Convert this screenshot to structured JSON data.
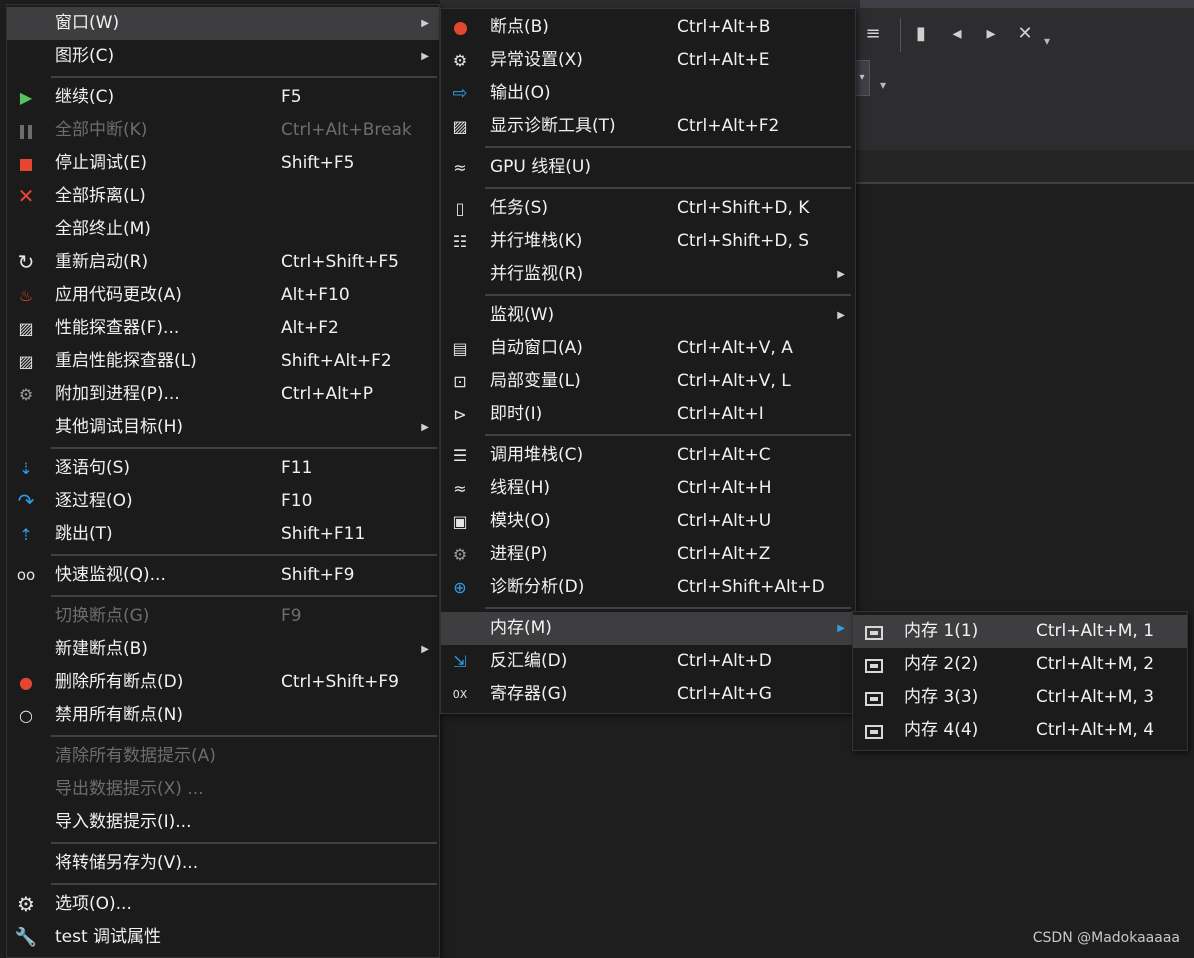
{
  "watermark": "CSDN @Madokaaaaa",
  "colors": {
    "menu_bg": "#1b1b1c",
    "highlight": "#3e3e40",
    "disabled": "#6d6d6d",
    "accent_red": "#e5462f",
    "accent_green": "#54c45e",
    "accent_blue": "#2f9ee8"
  },
  "main_menu": {
    "items": [
      {
        "label": "窗口(W)",
        "shortcut": "",
        "icon": "",
        "submenu": true,
        "highlighted": true
      },
      {
        "label": "图形(C)",
        "shortcut": "",
        "icon": "",
        "submenu": true
      },
      {
        "label": "继续(C)",
        "shortcut": "F5",
        "icon": "play-icon"
      },
      {
        "label": "全部中断(K)",
        "shortcut": "Ctrl+Alt+Break",
        "icon": "pause-icon",
        "disabled": true
      },
      {
        "label": "停止调试(E)",
        "shortcut": "Shift+F5",
        "icon": "stop-icon"
      },
      {
        "label": "全部拆离(L)",
        "shortcut": "",
        "icon": "close-icon"
      },
      {
        "label": "全部终止(M)",
        "shortcut": "",
        "icon": ""
      },
      {
        "label": "重新启动(R)",
        "shortcut": "Ctrl+Shift+F5",
        "icon": "restart-icon"
      },
      {
        "label": "应用代码更改(A)",
        "shortcut": "Alt+F10",
        "icon": "flame-icon"
      },
      {
        "label": "性能探查器(F)...",
        "shortcut": "Alt+F2",
        "icon": "performance-icon"
      },
      {
        "label": "重启性能探查器(L)",
        "shortcut": "Shift+Alt+F2",
        "icon": "performance-restart-icon"
      },
      {
        "label": "附加到进程(P)...",
        "shortcut": "Ctrl+Alt+P",
        "icon": "gears-icon"
      },
      {
        "label": "其他调试目标(H)",
        "shortcut": "",
        "icon": "",
        "submenu": true
      },
      {
        "label": "逐语句(S)",
        "shortcut": "F11",
        "icon": "step-into-icon"
      },
      {
        "label": "逐过程(O)",
        "shortcut": "F10",
        "icon": "step-over-icon"
      },
      {
        "label": "跳出(T)",
        "shortcut": "Shift+F11",
        "icon": "step-out-icon"
      },
      {
        "label": "快速监视(Q)...",
        "shortcut": "Shift+F9",
        "icon": "glasses-icon"
      },
      {
        "label": "切换断点(G)",
        "shortcut": "F9",
        "icon": "",
        "disabled": true
      },
      {
        "label": "新建断点(B)",
        "shortcut": "",
        "icon": "",
        "submenu": true
      },
      {
        "label": "删除所有断点(D)",
        "shortcut": "Ctrl+Shift+F9",
        "icon": "delete-breakpoints-icon"
      },
      {
        "label": "禁用所有断点(N)",
        "shortcut": "",
        "icon": "disable-breakpoints-icon"
      },
      {
        "label": "清除所有数据提示(A)",
        "shortcut": "",
        "icon": "",
        "disabled": true
      },
      {
        "label": "导出数据提示(X) ...",
        "shortcut": "",
        "icon": "",
        "disabled": true
      },
      {
        "label": "导入数据提示(I)...",
        "shortcut": "",
        "icon": ""
      },
      {
        "label": "将转储另存为(V)...",
        "shortcut": "",
        "icon": ""
      },
      {
        "label": "选项(O)...",
        "shortcut": "",
        "icon": "gear-icon"
      },
      {
        "label": "test 调试属性",
        "shortcut": "",
        "icon": "wrench-icon"
      }
    ]
  },
  "window_submenu": {
    "items": [
      {
        "label": "断点(B)",
        "shortcut": "Ctrl+Alt+B",
        "icon": "breakpoints-icon"
      },
      {
        "label": "异常设置(X)",
        "shortcut": "Ctrl+Alt+E",
        "icon": "exception-settings-icon"
      },
      {
        "label": "输出(O)",
        "shortcut": "",
        "icon": "output-icon"
      },
      {
        "label": "显示诊断工具(T)",
        "shortcut": "Ctrl+Alt+F2",
        "icon": "diagnostics-icon"
      },
      {
        "label": "GPU 线程(U)",
        "shortcut": "",
        "icon": "gpu-threads-icon"
      },
      {
        "label": "任务(S)",
        "shortcut": "Ctrl+Shift+D, K",
        "icon": "tasks-icon"
      },
      {
        "label": "并行堆栈(K)",
        "shortcut": "Ctrl+Shift+D, S",
        "icon": "parallel-stacks-icon"
      },
      {
        "label": "并行监视(R)",
        "shortcut": "",
        "icon": "",
        "submenu": true
      },
      {
        "label": "监视(W)",
        "shortcut": "",
        "icon": "",
        "submenu": true
      },
      {
        "label": "自动窗口(A)",
        "shortcut": "Ctrl+Alt+V, A",
        "icon": "autos-icon"
      },
      {
        "label": "局部变量(L)",
        "shortcut": "Ctrl+Alt+V, L",
        "icon": "locals-icon"
      },
      {
        "label": "即时(I)",
        "shortcut": "Ctrl+Alt+I",
        "icon": "immediate-icon"
      },
      {
        "label": "调用堆栈(C)",
        "shortcut": "Ctrl+Alt+C",
        "icon": "call-stack-icon"
      },
      {
        "label": "线程(H)",
        "shortcut": "Ctrl+Alt+H",
        "icon": "threads-icon"
      },
      {
        "label": "模块(O)",
        "shortcut": "Ctrl+Alt+U",
        "icon": "modules-icon"
      },
      {
        "label": "进程(P)",
        "shortcut": "Ctrl+Alt+Z",
        "icon": "processes-icon"
      },
      {
        "label": "诊断分析(D)",
        "shortcut": "Ctrl+Shift+Alt+D",
        "icon": "diagnostic-analysis-icon"
      },
      {
        "label": "内存(M)",
        "shortcut": "",
        "icon": "",
        "submenu": true,
        "highlighted": true
      },
      {
        "label": "反汇编(D)",
        "shortcut": "Ctrl+Alt+D",
        "icon": "disassembly-icon"
      },
      {
        "label": "寄存器(G)",
        "shortcut": "Ctrl+Alt+G",
        "icon": "registers-icon"
      }
    ]
  },
  "memory_submenu": {
    "items": [
      {
        "label": "内存 1(1)",
        "shortcut": "Ctrl+Alt+M, 1",
        "icon": "memory-icon",
        "highlighted": true
      },
      {
        "label": "内存 2(2)",
        "shortcut": "Ctrl+Alt+M, 2",
        "icon": "memory-icon"
      },
      {
        "label": "内存 3(3)",
        "shortcut": "Ctrl+Alt+M, 3",
        "icon": "memory-icon"
      },
      {
        "label": "内存 4(4)",
        "shortcut": "Ctrl+Alt+M, 4",
        "icon": "memory-icon"
      }
    ]
  }
}
